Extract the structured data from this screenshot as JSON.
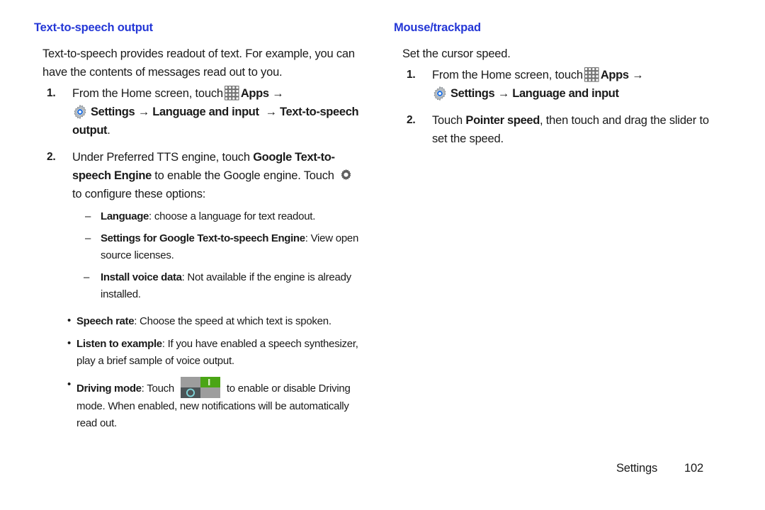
{
  "page": {
    "footer_label": "Settings",
    "page_number": "102",
    "heading_color": "#2437d6"
  },
  "left_column": {
    "heading": "Text-to-speech output",
    "intro": "Text-to-speech provides readout of text. For example, you can have the contents of messages read out to you.",
    "steps": [
      {
        "number": "1.",
        "text_before_apps": "From the Home screen, touch",
        "apps_label": "Apps",
        "arrow": "→",
        "settings_label": "Settings",
        "arrow2": "→",
        "language_label": "Language and input",
        "arrow3": "→",
        "tts_label": "Text-to-speech output",
        "trailing_period": "."
      },
      {
        "number": "2.",
        "part1": "Under Preferred TTS engine, touch ",
        "bold1": "Google Text-to-speech Engine",
        "part2": " to enable the Google engine. Touch ",
        "part3": " to configure these options:"
      }
    ],
    "sub_items": [
      {
        "dash": "–",
        "bold": "Language",
        "rest": ": choose a language for text readout."
      },
      {
        "dash": "–",
        "bold": "Settings for Google Text-to-speech Engine",
        "rest": ": View open source licenses."
      },
      {
        "dash": "–",
        "bold": "Install voice data",
        "rest": ": Not available if the engine is already installed."
      }
    ],
    "bullets": [
      {
        "marker": "•",
        "bold": "Speech rate",
        "rest": ": Choose the speed at which text is spoken."
      },
      {
        "marker": "•",
        "bold": "Listen to example",
        "rest": ": If you have enabled a speech synthesizer, play a brief sample of voice output."
      },
      {
        "marker": "•",
        "bold": "Driving mode",
        "before_toggle": ": Touch ",
        "after_toggle": " to enable or disable Driving mode. When enabled, new notifications will be automatically read out."
      }
    ]
  },
  "right_column": {
    "heading": "Mouse/trackpad",
    "intro": "Set the cursor speed.",
    "steps": [
      {
        "number": "1.",
        "text_before_apps": "From the Home screen, touch",
        "apps_label": "Apps",
        "arrow": "→",
        "settings_label": "Settings",
        "arrow2": "→",
        "language_label": "Language and input"
      },
      {
        "number": "2.",
        "part1": "Touch ",
        "bold1": "Pointer speed",
        "part2": ", then touch and drag the slider to set the speed."
      }
    ]
  },
  "icons": {
    "apps": "apps-grid-icon",
    "settings": "settings-gear-blue-icon",
    "configure": "gear-gray-icon",
    "driving_toggle": "toggle-switch-icon",
    "toggle_on_label": "I",
    "toggle_off_label": "O",
    "toggle_on_color": "#4aa515",
    "toggle_track_color": "#9d9d9d",
    "toggle_knob_color": "#4c5457"
  }
}
